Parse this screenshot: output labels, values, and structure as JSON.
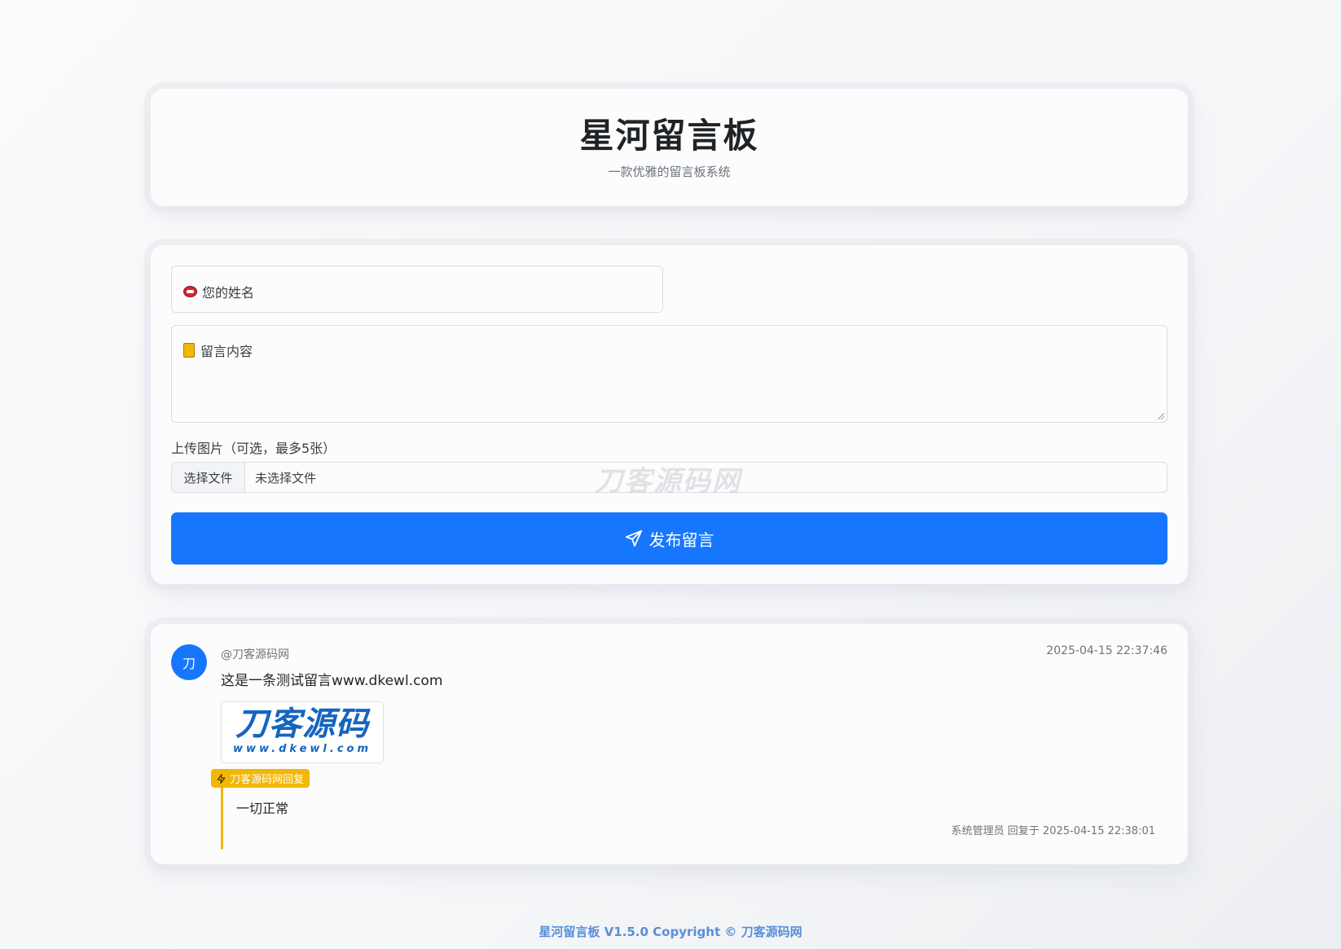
{
  "header": {
    "title": "星河留言板",
    "subtitle": "一款优雅的留言板系统"
  },
  "form": {
    "name_placeholder": "您的姓名",
    "content_placeholder": "留言内容",
    "upload_label": "上传图片（可选，最多5张）",
    "file_button": "选择文件",
    "file_status": "未选择文件",
    "submit_label": "发布留言",
    "watermark": "刀客源码网"
  },
  "messages": [
    {
      "avatar_char": "刀",
      "author": "@刀客源码网",
      "time": "2025-04-15 22:37:46",
      "content": "这是一条测试留言www.dkewl.com",
      "image": {
        "logo_text": "刀客源码",
        "url_text": "www.dkewl.com"
      },
      "reply": {
        "badge": "刀客源码网回复",
        "text": "一切正常",
        "meta": "系统管理员 回复于 2025-04-15 22:38:01"
      }
    }
  ],
  "footer": {
    "text": "星河留言板 V1.5.0 Copyright © 刀客源码网"
  },
  "colors": {
    "primary": "#1677fe",
    "reply_accent": "#f2b705",
    "footer_text": "#5a8ed6"
  }
}
